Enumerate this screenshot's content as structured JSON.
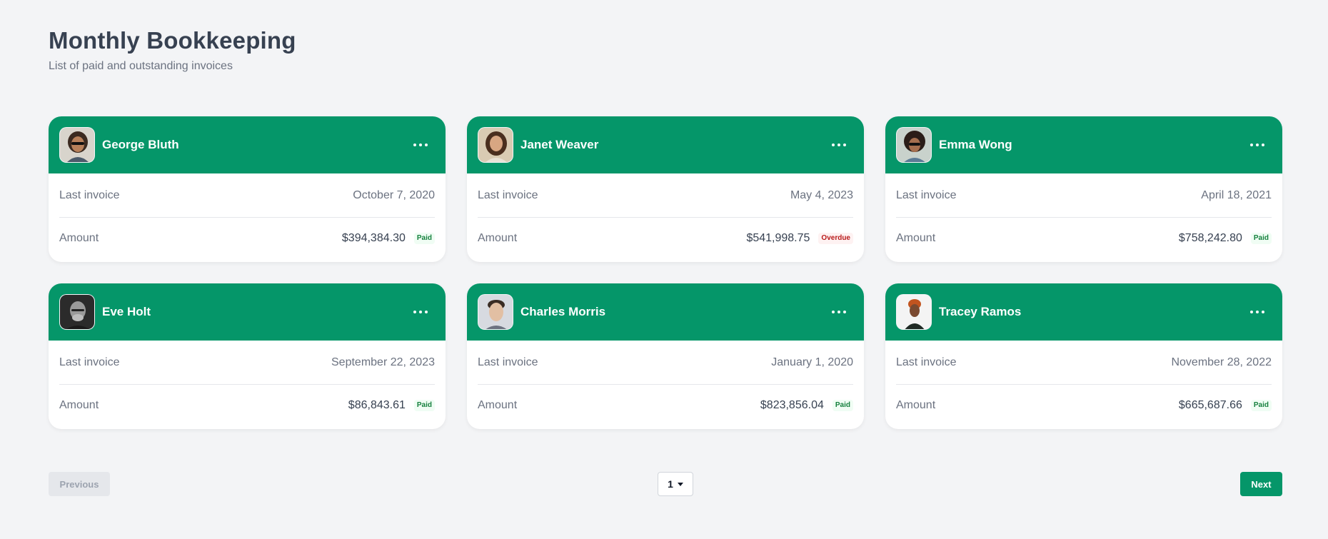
{
  "page": {
    "title": "Monthly Bookkeeping",
    "subtitle": "List of paid and outstanding invoices"
  },
  "labels": {
    "last_invoice": "Last invoice",
    "amount": "Amount"
  },
  "colors": {
    "accent": "#059669",
    "paid_text": "#15803d",
    "overdue_text": "#b91c1c",
    "background": "#f3f4f6"
  },
  "cards": [
    {
      "name": "George Bluth",
      "last_invoice": "October 7, 2020",
      "amount": "$394,384.30",
      "status": "Paid",
      "status_type": "paid",
      "avatar_icon": "avatar-george-bluth"
    },
    {
      "name": "Janet Weaver",
      "last_invoice": "May 4, 2023",
      "amount": "$541,998.75",
      "status": "Overdue",
      "status_type": "overdue",
      "avatar_icon": "avatar-janet-weaver"
    },
    {
      "name": "Emma Wong",
      "last_invoice": "April 18, 2021",
      "amount": "$758,242.80",
      "status": "Paid",
      "status_type": "paid",
      "avatar_icon": "avatar-emma-wong"
    },
    {
      "name": "Eve Holt",
      "last_invoice": "September 22, 2023",
      "amount": "$86,843.61",
      "status": "Paid",
      "status_type": "paid",
      "avatar_icon": "avatar-eve-holt"
    },
    {
      "name": "Charles Morris",
      "last_invoice": "January 1, 2020",
      "amount": "$823,856.04",
      "status": "Paid",
      "status_type": "paid",
      "avatar_icon": "avatar-charles-morris"
    },
    {
      "name": "Tracey Ramos",
      "last_invoice": "November 28, 2022",
      "amount": "$665,687.66",
      "status": "Paid",
      "status_type": "paid",
      "avatar_icon": "avatar-tracey-ramos"
    }
  ],
  "pagination": {
    "previous_label": "Previous",
    "next_label": "Next",
    "current_page": "1"
  }
}
